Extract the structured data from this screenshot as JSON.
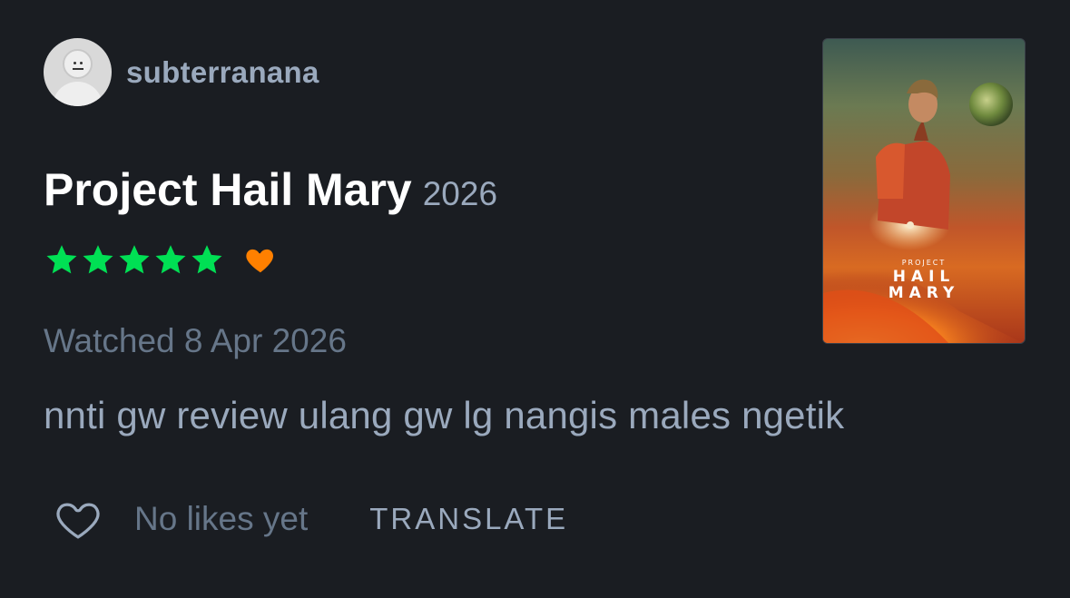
{
  "user": {
    "username": "subterranana",
    "avatar": "default-avatar-icon"
  },
  "film": {
    "title": "Project Hail Mary",
    "year": "2026",
    "poster": {
      "pre_title": "PROJECT",
      "line1": "HAIL",
      "line2": "MARY"
    }
  },
  "rating": {
    "stars": 5,
    "max_stars": 5,
    "liked": true,
    "star_color": "#00e054",
    "heart_color": "#ff8000"
  },
  "watched": "Watched 8 Apr 2026",
  "review": {
    "text": "nnti gw review ulang gw lg nangis males ngetik"
  },
  "actions": {
    "like_icon": "heart-outline-icon",
    "likes_label": "No likes yet",
    "translate_label": "TRANSLATE"
  },
  "colors": {
    "background": "#1a1d22",
    "muted_text": "#667689",
    "secondary_text": "#9aa9bd"
  }
}
